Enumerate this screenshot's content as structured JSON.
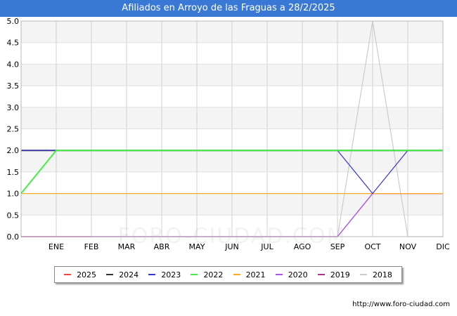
{
  "header": {
    "title": "Afiliados en Arroyo de las Fraguas a 28/2/2025"
  },
  "watermark": "FORO-CIUDAD.COM",
  "source": "http://www.foro-ciudad.com",
  "chart_data": {
    "type": "line",
    "title": "Afiliados en Arroyo de las Fraguas a 28/2/2025",
    "xlabel": "",
    "ylabel": "",
    "x": [
      "",
      "ENE",
      "FEB",
      "MAR",
      "ABR",
      "MAY",
      "JUN",
      "JUL",
      "AGO",
      "SEP",
      "OCT",
      "NOV",
      "DIC"
    ],
    "yticks": [
      "0.0",
      "0.5",
      "1.0",
      "1.5",
      "2.0",
      "2.5",
      "3.0",
      "3.5",
      "4.0",
      "4.5",
      "5.0"
    ],
    "ylim": [
      0,
      5
    ],
    "grid": true,
    "legend": "bottom",
    "series": [
      {
        "name": "2025",
        "color": "#ff4444",
        "values": [
          0,
          0,
          0
        ]
      },
      {
        "name": "2024",
        "color": "#333333",
        "values": [
          2,
          2,
          2,
          2,
          2,
          2,
          2,
          2,
          2,
          2,
          2,
          2,
          2
        ]
      },
      {
        "name": "2023",
        "color": "#3333dd",
        "values": [
          2,
          2,
          2,
          2,
          2,
          2,
          2,
          2,
          2,
          2,
          1,
          2,
          2
        ]
      },
      {
        "name": "2022",
        "color": "#44ee44",
        "values": [
          1,
          2,
          2,
          2,
          2,
          2,
          2,
          2,
          2,
          2,
          2,
          2,
          2
        ]
      },
      {
        "name": "2021",
        "color": "#ffaa22",
        "values": [
          1,
          1,
          1,
          1,
          1,
          1,
          1,
          1,
          1,
          1,
          1,
          1,
          1
        ]
      },
      {
        "name": "2020",
        "color": "#aa55ee",
        "values": [
          0,
          0,
          0,
          0,
          0,
          0,
          0,
          0,
          0,
          0,
          1,
          1,
          1
        ]
      },
      {
        "name": "2019",
        "color": "#aa3388",
        "values": [
          0,
          0,
          0,
          0,
          0,
          0,
          0,
          0,
          0,
          0,
          1,
          1,
          1
        ]
      },
      {
        "name": "2018",
        "color": "#cccccc",
        "values": [
          0,
          0,
          0,
          0,
          0,
          0,
          0,
          0,
          0,
          0,
          5,
          0,
          0
        ]
      }
    ]
  }
}
